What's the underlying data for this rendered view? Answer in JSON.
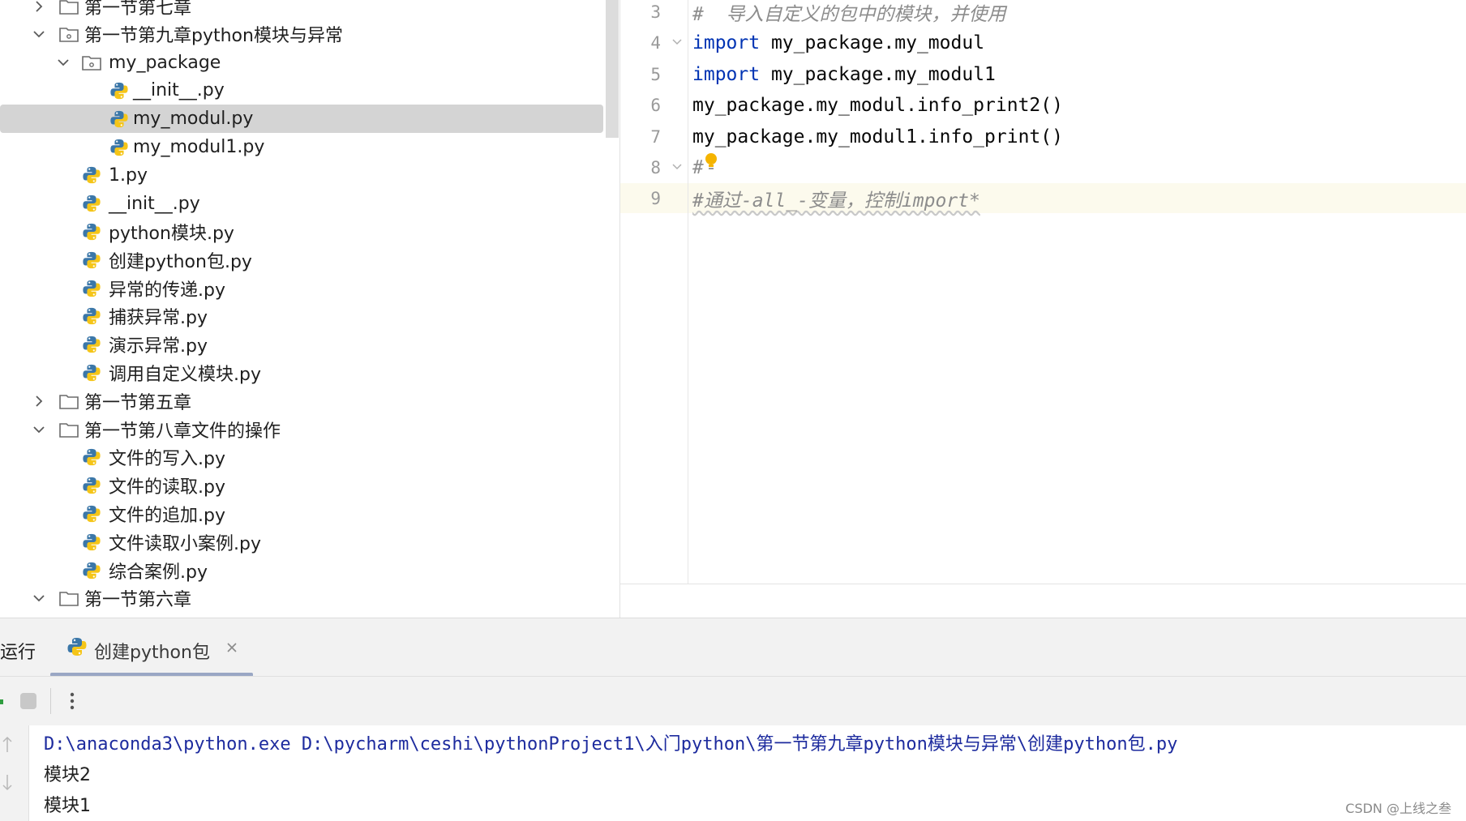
{
  "project_tree": {
    "items": [
      {
        "label": "第一节第七章",
        "depth": 1,
        "type": "folder",
        "expanded": false
      },
      {
        "label": "第一节第九章python模块与异常",
        "depth": 1,
        "type": "package",
        "expanded": true
      },
      {
        "label": "my_package",
        "depth": 2,
        "type": "package",
        "expanded": true
      },
      {
        "label": "__init__.py",
        "depth": 3,
        "type": "python-file"
      },
      {
        "label": "my_modul.py",
        "depth": 3,
        "type": "python-file",
        "selected": true
      },
      {
        "label": "my_modul1.py",
        "depth": 3,
        "type": "python-file"
      },
      {
        "label": "1.py",
        "depth": 2,
        "type": "python-file"
      },
      {
        "label": "__init__.py",
        "depth": 2,
        "type": "python-file"
      },
      {
        "label": "python模块.py",
        "depth": 2,
        "type": "python-file"
      },
      {
        "label": "创建python包.py",
        "depth": 2,
        "type": "python-file"
      },
      {
        "label": "异常的传递.py",
        "depth": 2,
        "type": "python-file"
      },
      {
        "label": "捕获异常.py",
        "depth": 2,
        "type": "python-file"
      },
      {
        "label": "演示异常.py",
        "depth": 2,
        "type": "python-file"
      },
      {
        "label": "调用自定义模块.py",
        "depth": 2,
        "type": "python-file"
      },
      {
        "label": "第一节第五章",
        "depth": 1,
        "type": "folder",
        "expanded": false
      },
      {
        "label": "第一节第八章文件的操作",
        "depth": 1,
        "type": "folder",
        "expanded": true
      },
      {
        "label": "文件的写入.py",
        "depth": 2,
        "type": "python-file"
      },
      {
        "label": "文件的读取.py",
        "depth": 2,
        "type": "python-file"
      },
      {
        "label": "文件的追加.py",
        "depth": 2,
        "type": "python-file"
      },
      {
        "label": "文件读取小案例.py",
        "depth": 2,
        "type": "python-file"
      },
      {
        "label": "综合案例.py",
        "depth": 2,
        "type": "python-file"
      },
      {
        "label": "第一节第六章",
        "depth": 1,
        "type": "folder",
        "expanded": true
      }
    ]
  },
  "editor": {
    "lines": [
      {
        "number": "3",
        "keyword": "",
        "text": "#  导入自定义的包中的模块，并使用",
        "style": "comment"
      },
      {
        "number": "4",
        "keyword": "import",
        "text": " my_package.my_modul",
        "style": "code"
      },
      {
        "number": "5",
        "keyword": "import",
        "text": " my_package.my_modul1",
        "style": "code"
      },
      {
        "number": "6",
        "keyword": "",
        "text": "my_package.my_modul.info_print2()",
        "style": "code"
      },
      {
        "number": "7",
        "keyword": "",
        "text": "my_package.my_modul1.info_print()",
        "style": "code"
      },
      {
        "number": "8",
        "keyword": "",
        "text": "#",
        "style": "comment"
      },
      {
        "number": "9",
        "keyword": "",
        "text": "#通过-all_-变量，控制import*",
        "style": "comment"
      }
    ]
  },
  "run_panel": {
    "title": "运行",
    "tab_label": "创建python包",
    "console_lines": [
      "D:\\anaconda3\\python.exe D:\\pycharm\\ceshi\\pythonProject1\\入门python\\第一节第九章python模块与异常\\创建python包.py",
      "模块2",
      "模块1"
    ]
  },
  "watermark": "CSDN @上线之叁",
  "colors": {
    "keyword": "#0033b3",
    "comment": "#8c8c8c",
    "console_path": "#1d2b9e",
    "selection": "#d4d4d4",
    "python_blue": "#3b77a8",
    "python_yellow": "#f5c518"
  }
}
